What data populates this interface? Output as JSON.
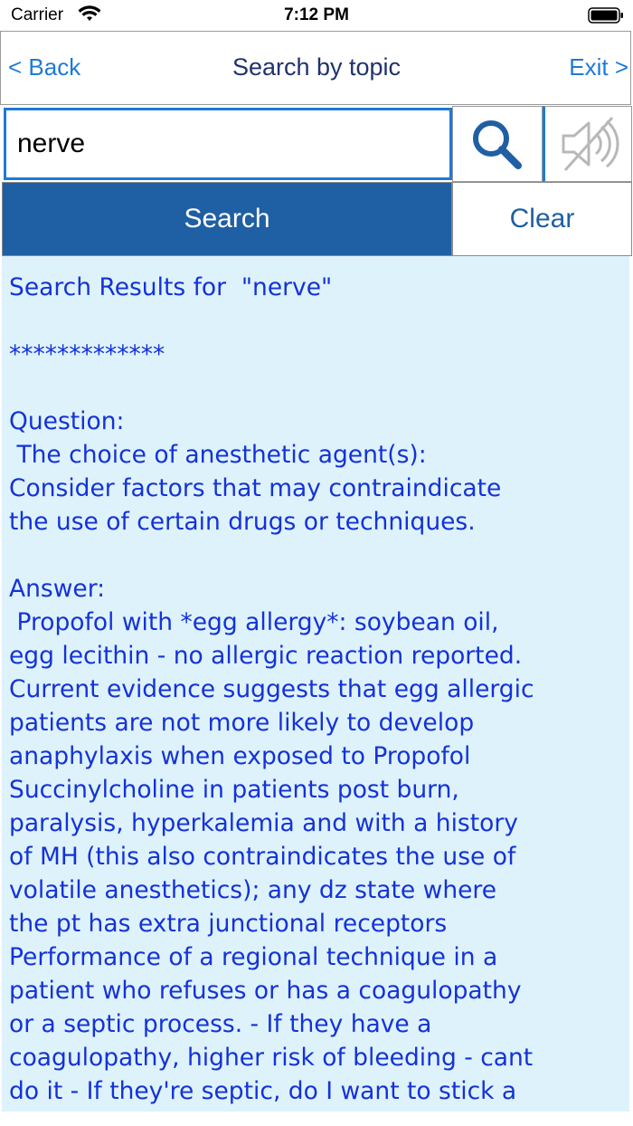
{
  "status_bar": {
    "carrier": "Carrier",
    "time": "7:12 PM"
  },
  "nav": {
    "back_label": "< Back",
    "title": "Search by topic",
    "exit_label": "Exit >"
  },
  "search": {
    "value": "nerve",
    "search_icon": "magnifier-icon",
    "sound_icon": "speaker-muted-icon"
  },
  "actions": {
    "search_label": "Search",
    "clear_label": "Clear"
  },
  "results": {
    "text": "Search Results for  \"nerve\"\n\n*************\n\nQuestion:\n The choice of anesthetic agent(s):\nConsider factors that may contraindicate\nthe use of certain drugs or techniques.\n\nAnswer:\n Propofol with *egg allergy*: soybean oil,\negg lecithin - no allergic reaction reported.\nCurrent evidence suggests that egg allergic\npatients are not more likely to develop\nanaphylaxis when exposed to Propofol\nSuccinylcholine in patients post burn,\nparalysis, hyperkalemia and with a history\nof MH (this also contraindicates the use of\nvolatile anesthetics); any dz state where\nthe pt has extra junctional receptors\nPerformance of a regional technique in a\npatient who refuses or has a coagulopathy\nor a septic process. - If they have a\ncoagulopathy, higher risk of bleeding - cant\ndo it - If they're septic, do I want to stick a"
  },
  "colors": {
    "accent": "#1e7ad6",
    "button_fill": "#1f5fa3",
    "result_bg": "#def2fb",
    "result_text": "#1432d8"
  }
}
